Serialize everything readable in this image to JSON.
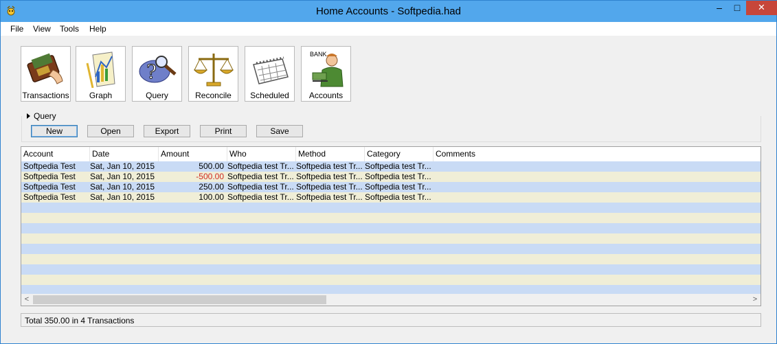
{
  "window": {
    "title": "Home Accounts - Softpedia.had",
    "minimize": "–",
    "maximize": "□",
    "close": "✕"
  },
  "menu": [
    "File",
    "View",
    "Tools",
    "Help"
  ],
  "toolbar": [
    {
      "label": "Transactions",
      "icon": "wallet-icon"
    },
    {
      "label": "Graph",
      "icon": "graph-icon"
    },
    {
      "label": "Query",
      "icon": "query-magnifier-icon"
    },
    {
      "label": "Reconcile",
      "icon": "scales-icon"
    },
    {
      "label": "Scheduled",
      "icon": "calendar-icon"
    },
    {
      "label": "Accounts",
      "icon": "bank-clerk-icon",
      "icon_text": "BANK"
    }
  ],
  "query": {
    "caption": "Query",
    "buttons": [
      "New",
      "Open",
      "Export",
      "Print",
      "Save"
    ]
  },
  "table": {
    "columns": [
      "Account",
      "Date",
      "Amount",
      "Who",
      "Method",
      "Category",
      "Comments"
    ],
    "rows": [
      {
        "account": "Softpedia Test",
        "date": "Sat, Jan 10, 2015",
        "amount": "500.00",
        "who": "Softpedia test Tr...",
        "method": "Softpedia test Tr...",
        "category": "Softpedia test Tr...",
        "comments": ""
      },
      {
        "account": "Softpedia Test",
        "date": "Sat, Jan 10, 2015",
        "amount": "-500.00",
        "who": "Softpedia test Tr...",
        "method": "Softpedia test Tr...",
        "category": "Softpedia test Tr...",
        "comments": ""
      },
      {
        "account": "Softpedia Test",
        "date": "Sat, Jan 10, 2015",
        "amount": "250.00",
        "who": "Softpedia test Tr...",
        "method": "Softpedia test Tr...",
        "category": "Softpedia test Tr...",
        "comments": ""
      },
      {
        "account": "Softpedia Test",
        "date": "Sat, Jan 10, 2015",
        "amount": "100.00",
        "who": "Softpedia test Tr...",
        "method": "Softpedia test Tr...",
        "category": "Softpedia test Tr...",
        "comments": ""
      }
    ]
  },
  "scrollbar": {
    "left_arrow": "<",
    "right_arrow": ">"
  },
  "status": {
    "text": "Total 350.00 in 4 Transactions"
  },
  "colors": {
    "titlebar": "#52a7ec",
    "row_blue": "#c9dbf5",
    "row_cream": "#f0eed7",
    "negative": "#d02a1f",
    "close": "#c7463a"
  }
}
